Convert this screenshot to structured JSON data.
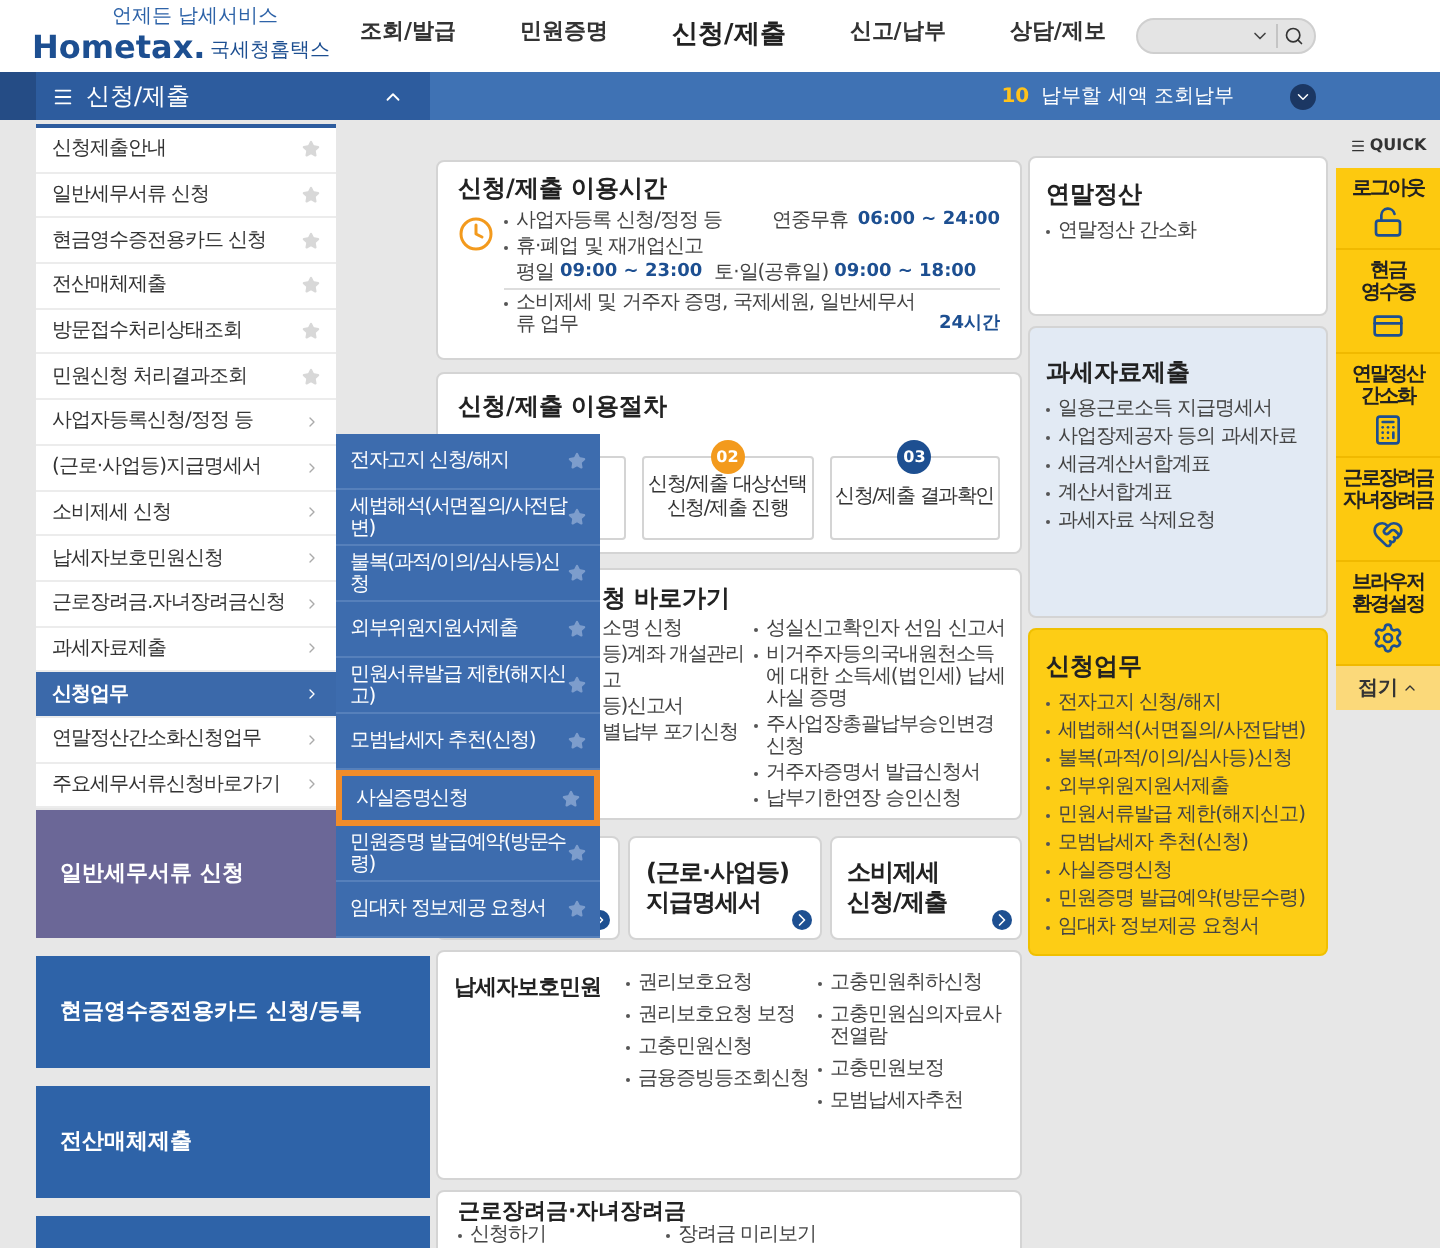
{
  "header": {
    "logo": {
      "tagline": "언제든 납세서비스",
      "brand": "Hometax.",
      "name": "국세청홈택스"
    },
    "nav": [
      {
        "label": "조회/발급",
        "selected": false
      },
      {
        "label": "민원증명",
        "selected": false
      },
      {
        "label": "신청/제출",
        "selected": true
      },
      {
        "label": "신고/납부",
        "selected": false
      },
      {
        "label": "상담/제보",
        "selected": false
      }
    ]
  },
  "section_bar": {
    "title": "신청/제출",
    "expanded": true,
    "notice_count": "10",
    "notice": "납부할 세액 조회납부"
  },
  "sidebar": {
    "items": [
      {
        "label": "신청제출안내",
        "kind": "star",
        "selected": false
      },
      {
        "label": "일반세무서류 신청",
        "kind": "star",
        "selected": false
      },
      {
        "label": "현금영수증전용카드 신청",
        "kind": "star",
        "selected": false
      },
      {
        "label": "전산매체제출",
        "kind": "star",
        "selected": false
      },
      {
        "label": "방문접수처리상태조회",
        "kind": "star",
        "selected": false
      },
      {
        "label": "민원신청 처리결과조회",
        "kind": "star",
        "selected": false
      },
      {
        "label": "사업자등록신청/정정 등",
        "kind": "arrow",
        "selected": false
      },
      {
        "label": "(근로·사업등)지급명세서",
        "kind": "arrow",
        "selected": false
      },
      {
        "label": "소비제세 신청",
        "kind": "arrow",
        "selected": false
      },
      {
        "label": "납세자보호민원신청",
        "kind": "arrow",
        "selected": false
      },
      {
        "label": "근로장려금.자녀장려금신청",
        "kind": "arrow",
        "selected": false
      },
      {
        "label": "과세자료제출",
        "kind": "arrow",
        "selected": false
      },
      {
        "label": "신청업무",
        "kind": "arrow",
        "selected": true
      },
      {
        "label": "연말정산간소화신청업무",
        "kind": "arrow",
        "selected": false
      },
      {
        "label": "주요세무서류신청바로가기",
        "kind": "arrow",
        "selected": false
      }
    ],
    "submenu": [
      {
        "label": "전자고지 신청/해지",
        "selected": false
      },
      {
        "label": "세법해석(서면질의/사전답변)",
        "selected": false
      },
      {
        "label": "불복(과적/이의/심사등)신청",
        "selected": false
      },
      {
        "label": "외부위원지원서제출",
        "selected": false
      },
      {
        "label": "민원서류발급 제한(해지신고)",
        "selected": false
      },
      {
        "label": "모범납세자 추천(신청)",
        "selected": false
      },
      {
        "label": "사실증명신청",
        "selected": true
      },
      {
        "label": "민원증명 발급예약(방문수령)",
        "selected": false
      },
      {
        "label": "임대차 정보제공 요청서",
        "selected": false
      }
    ]
  },
  "tiles": [
    {
      "label": "일반세무서류 신청",
      "color": "#6b6797"
    },
    {
      "label": "현금영수증전용카드 신청/등록",
      "color": "#2e63a8"
    },
    {
      "label": "전산매체제출",
      "color": "#2e63a8"
    },
    {
      "color": "#2e63a8"
    }
  ],
  "hours_card": {
    "title": "신청/제출 이용시간",
    "rows": [
      {
        "kind": "bullet",
        "label": "사업자등록 신청/정정 등",
        "detail": "연중무휴",
        "time": "06:00 ~ 24:00"
      },
      {
        "kind": "bullet",
        "label": "휴·폐업 및 재개업신고"
      },
      {
        "kind": "schedule",
        "segments": [
          {
            "text": "평일",
            "time": "09:00 ~ 23:00"
          },
          {
            "text": "토·일(공휴일)",
            "time": "09:00 ~ 18:00"
          }
        ]
      },
      {
        "kind": "bullet",
        "label": "소비제세 및 거주자 증명, 국제세원, 일반세무서류 업무",
        "time": "24시간"
      }
    ]
  },
  "steps_card": {
    "title": "신청/제출 이용절차",
    "steps": [
      {
        "number": "02",
        "lines": [
          "신청/제출 대상선택",
          "신청/제출 진행"
        ],
        "color": "#f39a1d"
      },
      {
        "number": "03",
        "lines": [
          "신청/제출 결과확인"
        ],
        "color": "#1d4f91"
      }
    ]
  },
  "shortcut_card": {
    "title": "청 바로가기",
    "left_items": [
      "소명 신청",
      "등)계좌 개설관리",
      "고",
      "등)신고서",
      "별납부 포기신청"
    ],
    "right_items": [
      "성실신고확인자 선임 신고서",
      "비거주자등의국내원천소득에 대한 소득세(법인세) 납세사실 증명",
      "주사업장총괄납부승인변경신청",
      "거주자증명서 발급신청서",
      "납부기한연장 승인신청"
    ]
  },
  "link_cards": [
    {
      "lines": [
        "(근로·사업등)",
        "지급명세서"
      ]
    },
    {
      "lines": [
        "소비제세",
        "신청/제출"
      ]
    }
  ],
  "taxpayer_card": {
    "title": "납세자보호민원",
    "left_items": [
      "권리보호요청",
      "권리보호요청 보정",
      "고충민원신청",
      "금융증빙등조회신청"
    ],
    "right_items": [
      "고충민원취하신청",
      "고충민원심의자료사전열람",
      "고충민원보정",
      "모범납세자추천"
    ]
  },
  "incentive_card": {
    "title": "근로장려금·자녀장려금",
    "items": [
      "신청하기",
      "장려금 미리보기"
    ]
  },
  "year_end_card": {
    "title": "연말정산",
    "items": [
      "연말정산 간소화"
    ]
  },
  "tax_data_card": {
    "title": "과세자료제출",
    "items": [
      "일용근로소득 지급명세서",
      "사업장제공자 등의 과세자료",
      "세금계산서합계표",
      "계산서합계표",
      "과세자료 삭제요청"
    ]
  },
  "application_card": {
    "title": "신청업무",
    "items": [
      "전자고지 신청/해지",
      "세법해석(서면질의/사전답변)",
      "불복(과적/이의/심사등)신청",
      "외부위원지원서제출",
      "민원서류발급 제한(해지신고)",
      "모범납세자 추천(신청)",
      "사실증명신청",
      "민원증명 발급예약(방문수령)",
      "임대차 정보제공 요청서"
    ]
  },
  "quick_menu": {
    "title": "QUICK",
    "items": [
      {
        "lines": [
          "로그아웃"
        ],
        "kind": "lock"
      },
      {
        "lines": [
          "현금",
          "영수증"
        ],
        "kind": "receipt"
      },
      {
        "lines": [
          "연말정산",
          "간소화"
        ],
        "kind": "calc"
      },
      {
        "lines": [
          "근로장려금",
          "자녀장려금"
        ],
        "kind": "heart"
      },
      {
        "lines": [
          "브라우저",
          "환경설정"
        ],
        "kind": "gear"
      }
    ],
    "collapse": "접기"
  }
}
